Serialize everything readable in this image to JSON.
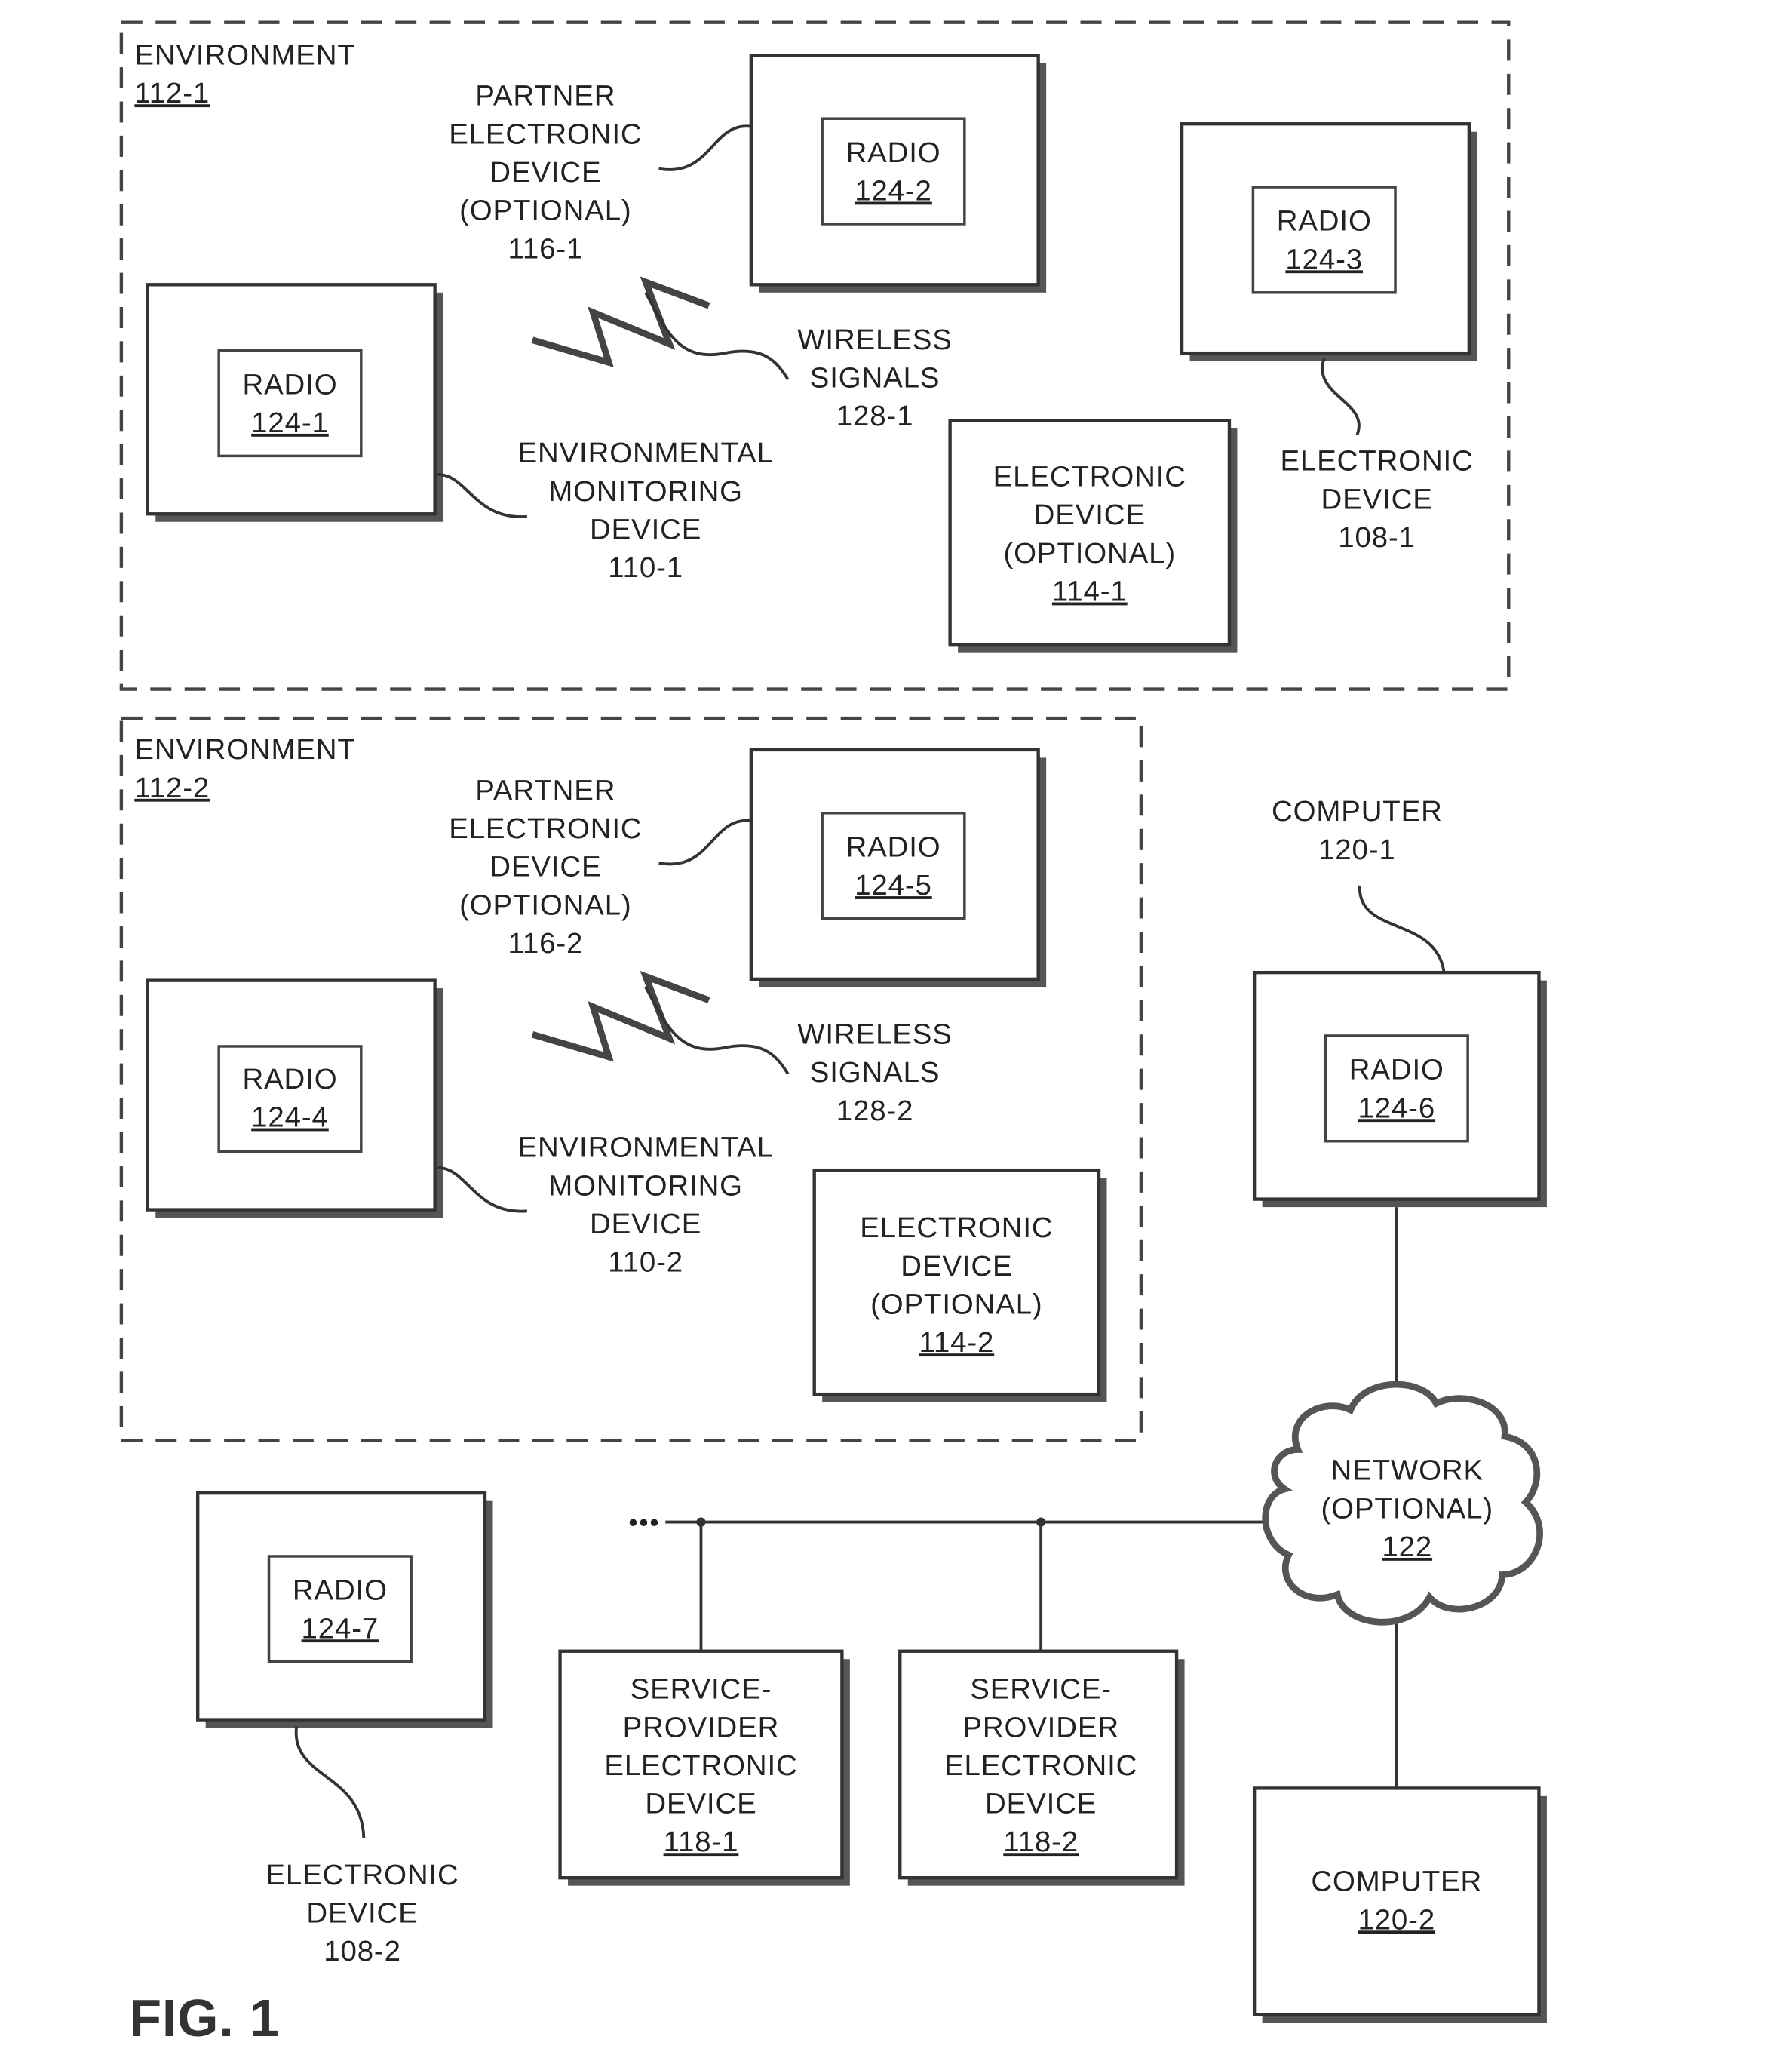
{
  "figure_label": "FIG. 1",
  "environments": [
    {
      "title": "ENVIRONMENT",
      "ref": "112-1"
    },
    {
      "title": "ENVIRONMENT",
      "ref": "112-2"
    }
  ],
  "radios": {
    "r1": {
      "label": "RADIO",
      "ref": "124-1"
    },
    "r2": {
      "label": "RADIO",
      "ref": "124-2"
    },
    "r3": {
      "label": "RADIO",
      "ref": "124-3"
    },
    "r4": {
      "label": "RADIO",
      "ref": "124-4"
    },
    "r5": {
      "label": "RADIO",
      "ref": "124-5"
    },
    "r6": {
      "label": "RADIO",
      "ref": "124-6"
    },
    "r7": {
      "label": "RADIO",
      "ref": "124-7"
    }
  },
  "callouts": {
    "partner1": [
      "PARTNER",
      "ELECTRONIC",
      "DEVICE",
      "(OPTIONAL)",
      "116-1"
    ],
    "partner2": [
      "PARTNER",
      "ELECTRONIC",
      "DEVICE",
      "(OPTIONAL)",
      "116-2"
    ],
    "wireless1": [
      "WIRELESS",
      "SIGNALS",
      "128-1"
    ],
    "wireless2": [
      "WIRELESS",
      "SIGNALS",
      "128-2"
    ],
    "envmon1": [
      "ENVIRONMENTAL",
      "MONITORING",
      "DEVICE",
      "110-1"
    ],
    "envmon2": [
      "ENVIRONMENTAL",
      "MONITORING",
      "DEVICE",
      "110-2"
    ],
    "elec1": [
      "ELECTRONIC",
      "DEVICE",
      "108-1"
    ],
    "elec2": [
      "ELECTRONIC",
      "DEVICE",
      "108-2"
    ],
    "computer1": [
      "COMPUTER",
      "120-1"
    ]
  },
  "boxes": {
    "optional1": {
      "lines": [
        "ELECTRONIC",
        "DEVICE",
        "(OPTIONAL)"
      ],
      "ref": "114-1"
    },
    "optional2": {
      "lines": [
        "ELECTRONIC",
        "DEVICE",
        "(OPTIONAL)"
      ],
      "ref": "114-2"
    },
    "sp1": {
      "lines": [
        "SERVICE-",
        "PROVIDER",
        "ELECTRONIC",
        "DEVICE"
      ],
      "ref": "118-1"
    },
    "sp2": {
      "lines": [
        "SERVICE-",
        "PROVIDER",
        "ELECTRONIC",
        "DEVICE"
      ],
      "ref": "118-2"
    },
    "computer2": {
      "lines": [
        "COMPUTER"
      ],
      "ref": "120-2"
    }
  },
  "network": {
    "lines": [
      "NETWORK",
      "(OPTIONAL)"
    ],
    "ref": "122"
  },
  "ellipsis": "•••"
}
